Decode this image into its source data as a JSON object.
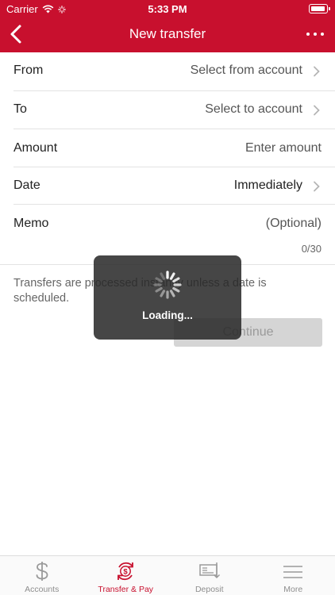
{
  "status_bar": {
    "carrier": "Carrier",
    "time": "5:33 PM"
  },
  "nav": {
    "title": "New transfer",
    "back_icon": "chevron-left-icon",
    "more_icon": "more-dots-icon"
  },
  "form": {
    "from": {
      "label": "From",
      "value": "Select from account"
    },
    "to": {
      "label": "To",
      "value": "Select to account"
    },
    "amount": {
      "label": "Amount",
      "placeholder": "Enter amount"
    },
    "date": {
      "label": "Date",
      "value": "Immediately"
    },
    "memo": {
      "label": "Memo",
      "placeholder": "(Optional)",
      "counter": "0/30"
    }
  },
  "note": "Transfers are processed instantly unless a date is scheduled.",
  "continue_label": "Continue",
  "loading": {
    "text": "Loading..."
  },
  "tabs": [
    {
      "label": "Accounts",
      "icon": "dollar-icon",
      "active": false
    },
    {
      "label": "Transfer & Pay",
      "icon": "transfer-pay-icon",
      "active": true
    },
    {
      "label": "Deposit",
      "icon": "check-deposit-icon",
      "active": false
    },
    {
      "label": "More",
      "icon": "menu-icon",
      "active": false
    }
  ],
  "colors": {
    "brand": "#c8102e",
    "overlay": "#282828",
    "disabled_button": "#d5d5d5"
  }
}
